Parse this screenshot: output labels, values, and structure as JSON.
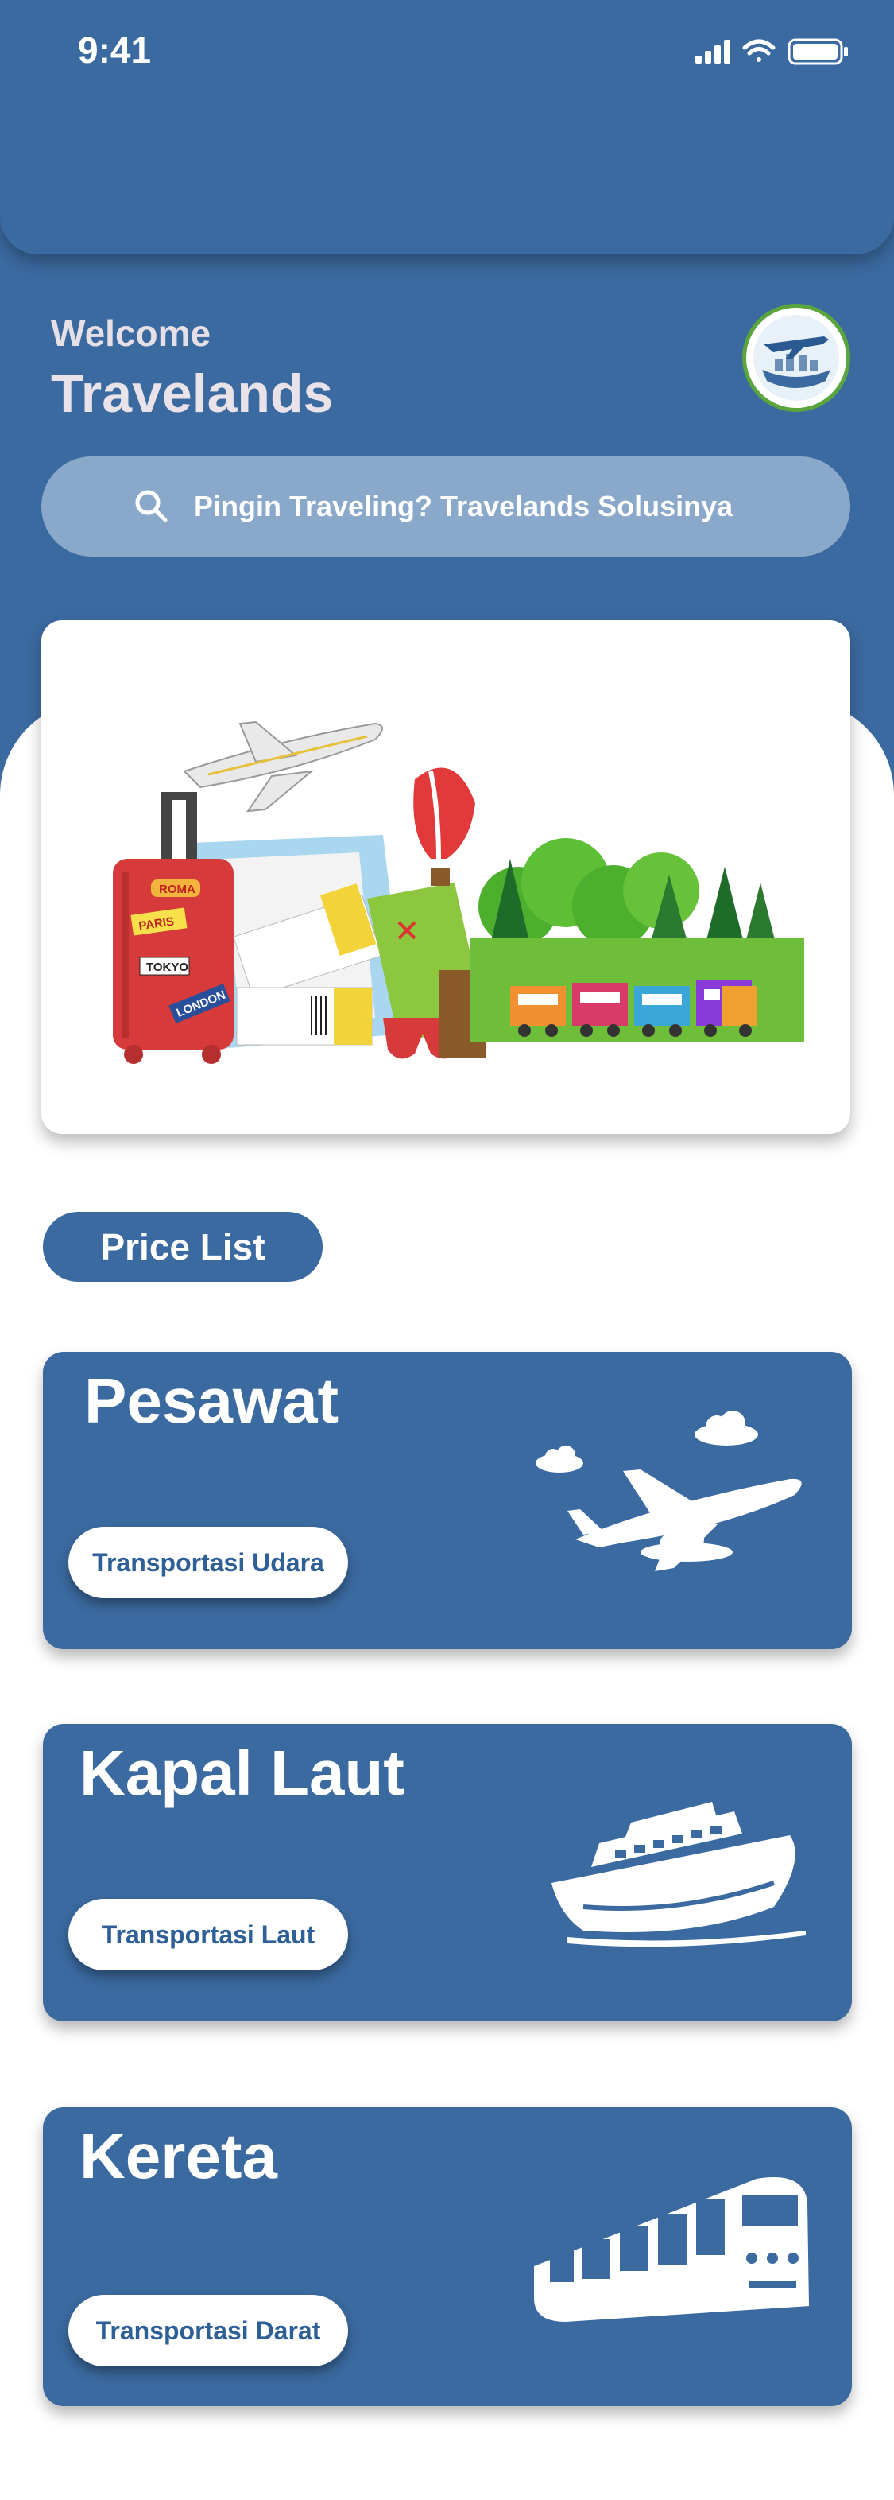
{
  "status": {
    "time": "9:41"
  },
  "header": {
    "welcome": "Welcome",
    "brand": "Travelands"
  },
  "search": {
    "placeholder": "Pingin Traveling? Travelands Solusinya"
  },
  "hero": {
    "luggage_tags": [
      "ROMA",
      "PARIS",
      "TOKYO",
      "LONDON"
    ]
  },
  "price_list": {
    "label": "Price List"
  },
  "cards": [
    {
      "title": "Pesawat",
      "button": "Transportasi Udara",
      "icon": "airplane-icon"
    },
    {
      "title": "Kapal Laut",
      "button": "Transportasi Laut",
      "icon": "ship-icon"
    },
    {
      "title": "Kereta",
      "button": "Transportasi Darat",
      "icon": "train-icon"
    }
  ],
  "colors": {
    "primary": "#3b6aa0",
    "search_bg": "#8aa8c9",
    "logo_ring": "#5aa53d"
  }
}
